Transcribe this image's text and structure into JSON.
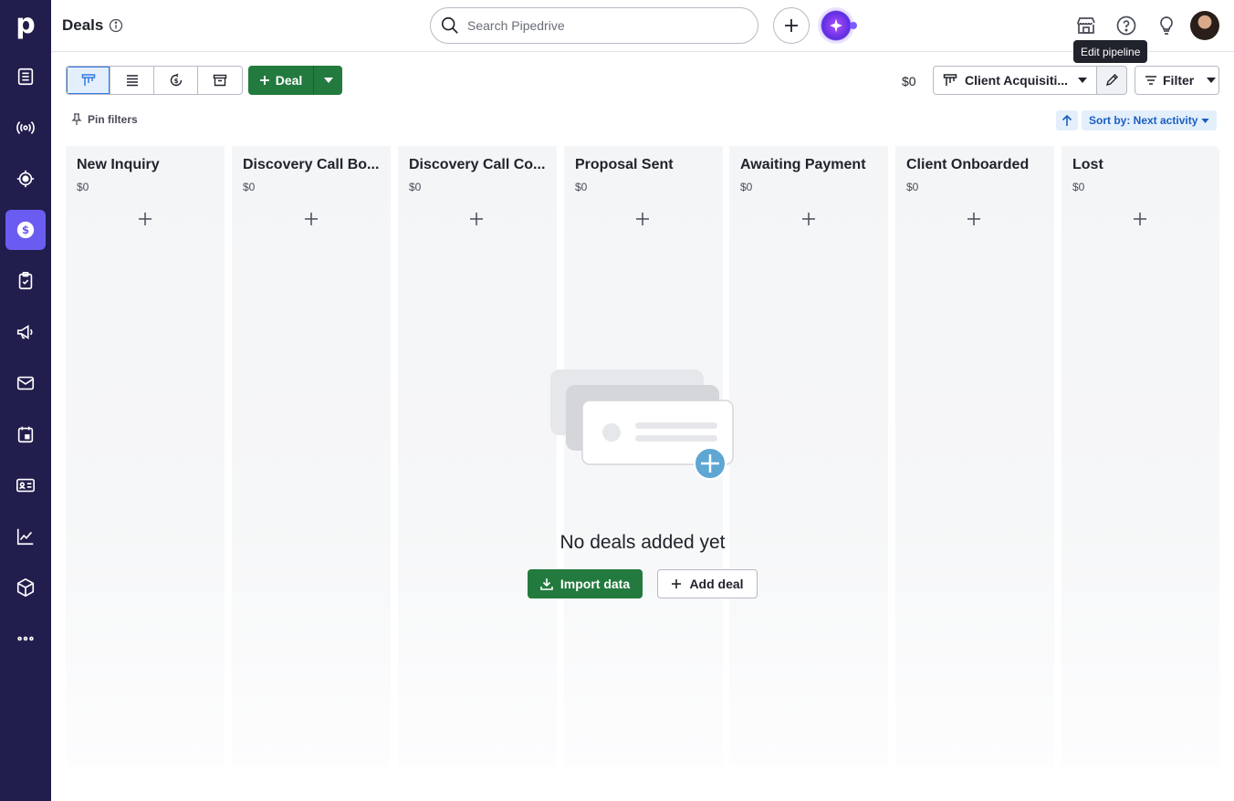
{
  "app": {
    "logo_letter": "p"
  },
  "header": {
    "title": "Deals",
    "search_placeholder": "Search Pipedrive",
    "tooltip": "Edit pipeline"
  },
  "sidebar": {
    "items": [
      {
        "name": "leads-inbox",
        "icon": "leads-icon"
      },
      {
        "name": "campaigns-signal",
        "icon": "broadcast-icon"
      },
      {
        "name": "projects",
        "icon": "target-icon"
      },
      {
        "name": "deals",
        "icon": "dollar-icon",
        "active": true
      },
      {
        "name": "activities",
        "icon": "clipboard-check-icon"
      },
      {
        "name": "campaigns",
        "icon": "megaphone-icon"
      },
      {
        "name": "mail",
        "icon": "mail-icon"
      },
      {
        "name": "calendar",
        "icon": "calendar-icon"
      },
      {
        "name": "contacts",
        "icon": "contact-card-icon"
      },
      {
        "name": "insights",
        "icon": "chart-icon"
      },
      {
        "name": "products",
        "icon": "box-icon"
      },
      {
        "name": "more",
        "icon": "more-icon"
      }
    ]
  },
  "toolbar": {
    "deal_label": "Deal",
    "total_value": "$0",
    "pipeline_label": "Client Acquisiti...",
    "filter_label": "Filter",
    "pin_filters_label": "Pin filters",
    "sort_label": "Sort by: Next activity"
  },
  "stages": [
    {
      "title": "New Inquiry",
      "amount": "$0"
    },
    {
      "title": "Discovery Call Bo...",
      "amount": "$0"
    },
    {
      "title": "Discovery Call Co...",
      "amount": "$0"
    },
    {
      "title": "Proposal Sent",
      "amount": "$0"
    },
    {
      "title": "Awaiting Payment",
      "amount": "$0"
    },
    {
      "title": "Client Onboarded",
      "amount": "$0"
    },
    {
      "title": "Lost",
      "amount": "$0"
    }
  ],
  "empty_state": {
    "message": "No deals added yet",
    "import_label": "Import data",
    "add_deal_label": "Add deal"
  },
  "colors": {
    "sidebar_bg": "#211e4d",
    "active_nav": "#6a5cf0",
    "primary_green": "#237a3e",
    "accent_blue": "#317ae2"
  }
}
